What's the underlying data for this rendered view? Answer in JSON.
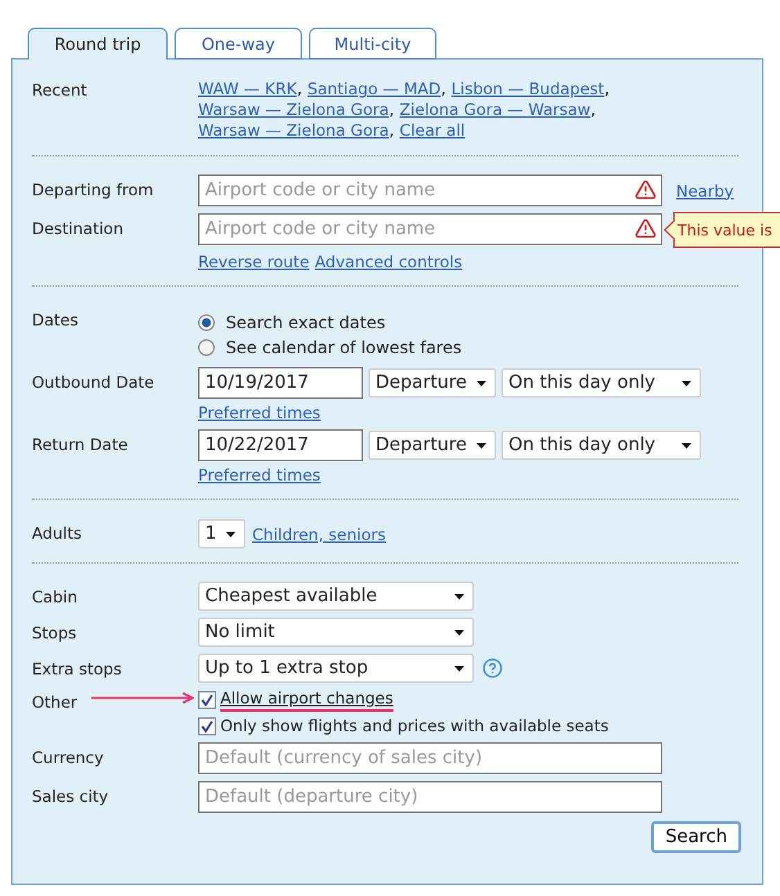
{
  "tabs": [
    {
      "label": "Round trip",
      "selected": true
    },
    {
      "label": "One-way",
      "selected": false
    },
    {
      "label": "Multi-city",
      "selected": false
    }
  ],
  "recent": {
    "label": "Recent",
    "links": [
      {
        "text": "WAW — KRK",
        "after": ","
      },
      {
        "text": "Santiago — MAD",
        "after": ","
      },
      {
        "text": "Lisbon — Budapest",
        "after": ","
      },
      {
        "text": "Warsaw — Zielona Gora",
        "after": ","
      },
      {
        "text": "Zielona Gora — Warsaw",
        "after": ","
      },
      {
        "text": "Warsaw — Zielona Gora",
        "after": ","
      },
      {
        "text": "Clear all"
      }
    ]
  },
  "route": {
    "departing": {
      "label": "Departing from",
      "placeholder": "Airport code or city name",
      "error": true,
      "link": "Nearby"
    },
    "destination": {
      "label": "Destination",
      "placeholder": "Airport code or city name",
      "error": true,
      "tooltip": "This value is"
    },
    "links": [
      "Reverse route",
      "Advanced controls"
    ]
  },
  "dates": {
    "label": "Dates",
    "options": [
      {
        "label": "Search exact dates",
        "selected": true
      },
      {
        "label": "See calendar of lowest fares",
        "selected": false
      }
    ],
    "legs": [
      {
        "label": "Outbound Date",
        "date": "10/19/2017",
        "time_type": "Departure",
        "range": "On this day only",
        "link": "Preferred times"
      },
      {
        "label": "Return Date",
        "date": "10/22/2017",
        "time_type": "Departure",
        "range": "On this day only",
        "link": "Preferred times"
      }
    ]
  },
  "passengers": {
    "label": "Adults",
    "adults": "1",
    "link": "Children, seniors"
  },
  "options": [
    {
      "kind": "select",
      "label": "Cabin",
      "value": "Cheapest available"
    },
    {
      "kind": "select",
      "label": "Stops",
      "value": "No limit"
    },
    {
      "kind": "select",
      "label": "Extra stops",
      "value": "Up to 1 extra stop",
      "help": true
    },
    {
      "kind": "checks",
      "label": "Other",
      "items": [
        {
          "label": "Allow airport changes",
          "checked": true,
          "highlighted": true
        },
        {
          "label": "Only show flights and prices with available seats",
          "checked": true,
          "highlighted": false
        }
      ]
    },
    {
      "kind": "input",
      "label": "Currency",
      "placeholder": "Default (currency of sales city)"
    },
    {
      "kind": "input",
      "label": "Sales city",
      "placeholder": "Default (departure city)"
    }
  ],
  "search_button": "Search"
}
